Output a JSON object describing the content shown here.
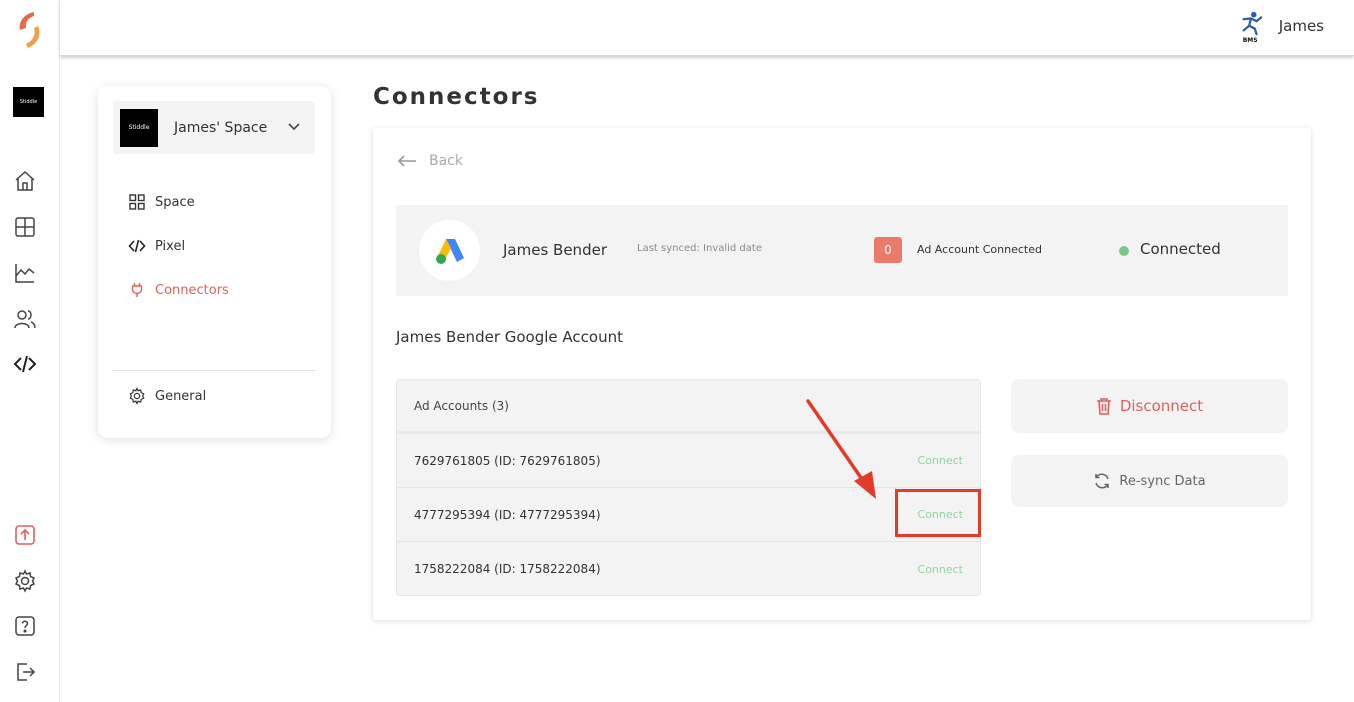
{
  "app": {
    "brand_logo": "brand-logo-icon",
    "workspace_thumb_text": "Stiddle"
  },
  "rail": {
    "icons": [
      "home-icon",
      "dashboard-icon",
      "analytics-icon",
      "users-icon",
      "code-icon",
      "upload-icon",
      "settings-icon",
      "help-icon",
      "logout-icon"
    ]
  },
  "topbar": {
    "user_name": "James",
    "user_logo_text": "BMS"
  },
  "sidebar": {
    "space_name": "James' Space",
    "space_thumb_text": "Stiddle",
    "items": [
      {
        "label": "Space",
        "icon": "grid-icon"
      },
      {
        "label": "Pixel",
        "icon": "code-icon"
      },
      {
        "label": "Connectors",
        "icon": "plug-icon"
      }
    ],
    "general_label": "General"
  },
  "page": {
    "title": "Connectors",
    "back_label": "Back"
  },
  "account": {
    "name": "James Bender",
    "last_synced": "Last synced: Invalid date",
    "ad_account_count": "0",
    "ad_account_label": "Ad Account Connected",
    "status": "Connected",
    "colors": {
      "badge": "#ea7a6a",
      "status_dot": "#7cc88a",
      "accent": "#e0605a"
    }
  },
  "google_account": {
    "title": "James Bender Google Account",
    "table_header": "Ad Accounts (3)",
    "rows": [
      {
        "label": "7629761805 (ID: 7629761805)",
        "action": "Connect"
      },
      {
        "label": "4777295394 (ID: 4777295394)",
        "action": "Connect"
      },
      {
        "label": "1758222084 (ID: 1758222084)",
        "action": "Connect"
      }
    ]
  },
  "actions": {
    "disconnect_label": "Disconnect",
    "resync_label": "Re-sync Data"
  }
}
